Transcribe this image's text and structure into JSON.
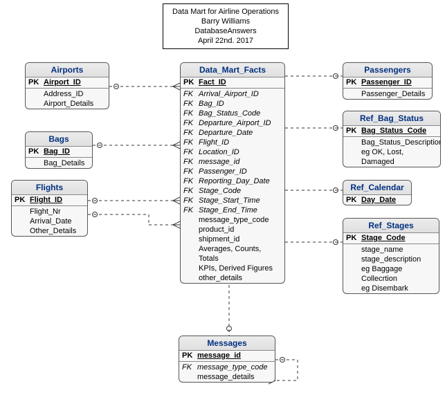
{
  "title": {
    "line1": "Data Mart for Airline Operations",
    "line2": "Barry Williams",
    "line3": "DatabaseAnswers",
    "line4": "April 22nd. 2017"
  },
  "entities": {
    "facts": {
      "name": "Data_Mart_Facts",
      "rows": [
        {
          "key": "PK",
          "style": "pk",
          "name": "Fact_ID"
        },
        {
          "key": "FK",
          "style": "fk",
          "name": "Arrival_Airport_ID"
        },
        {
          "key": "FK",
          "style": "fk",
          "name": "Bag_ID"
        },
        {
          "key": "FK",
          "style": "fk",
          "name": "Bag_Status_Code"
        },
        {
          "key": "FK",
          "style": "fk",
          "name": "Departure_Airport_ID"
        },
        {
          "key": "FK",
          "style": "fk",
          "name": "Departure_Date"
        },
        {
          "key": "FK",
          "style": "fk",
          "name": "Flight_ID"
        },
        {
          "key": "FK",
          "style": "fk",
          "name": "Location_ID"
        },
        {
          "key": "FK",
          "style": "fk",
          "name": "message_id"
        },
        {
          "key": "FK",
          "style": "fk",
          "name": "Passenger_ID"
        },
        {
          "key": "FK",
          "style": "fk",
          "name": "Reporting_Day_Date"
        },
        {
          "key": "FK",
          "style": "fk",
          "name": "Stage_Code"
        },
        {
          "key": "FK",
          "style": "fk",
          "name": "Stage_Start_Time"
        },
        {
          "key": "FK",
          "style": "fk",
          "name": "Stage_End_Time"
        },
        {
          "key": "",
          "style": "",
          "name": "message_type_code"
        },
        {
          "key": "",
          "style": "",
          "name": "product_id"
        },
        {
          "key": "",
          "style": "",
          "name": "shipment_id"
        },
        {
          "key": "",
          "style": "",
          "name": "Averages, Counts, Totals"
        },
        {
          "key": "",
          "style": "",
          "name": "KPIs, Derived Figures"
        },
        {
          "key": "",
          "style": "",
          "name": "other_details"
        }
      ]
    },
    "airports": {
      "name": "Airports",
      "rows": [
        {
          "key": "PK",
          "style": "pk",
          "name": "Airport_ID"
        },
        {
          "key": "",
          "style": "",
          "name": "Address_ID"
        },
        {
          "key": "",
          "style": "",
          "name": "Airport_Details"
        }
      ]
    },
    "bags": {
      "name": "Bags",
      "rows": [
        {
          "key": "PK",
          "style": "pk",
          "name": "Bag_ID"
        },
        {
          "key": "",
          "style": "",
          "name": "Bag_Details"
        }
      ]
    },
    "flights": {
      "name": "Flights",
      "rows": [
        {
          "key": "PK",
          "style": "pk",
          "name": "Flight_ID"
        },
        {
          "key": "",
          "style": "",
          "name": "Flight_Nr"
        },
        {
          "key": "",
          "style": "",
          "name": "Arrival_Date"
        },
        {
          "key": "",
          "style": "",
          "name": "Other_Details"
        }
      ]
    },
    "passengers": {
      "name": "Passengers",
      "rows": [
        {
          "key": "PK",
          "style": "pk",
          "name": "Passenger_ID"
        },
        {
          "key": "",
          "style": "",
          "name": "Passenger_Details"
        }
      ]
    },
    "ref_bag_status": {
      "name": "Ref_Bag_Status",
      "rows": [
        {
          "key": "PK",
          "style": "pk",
          "name": "Bag_Status_Code"
        },
        {
          "key": "",
          "style": "",
          "name": "Bag_Status_Description"
        },
        {
          "key": "",
          "style": "",
          "name": "eg OK, Lost, Damaged"
        }
      ]
    },
    "ref_calendar": {
      "name": "Ref_Calendar",
      "rows": [
        {
          "key": "PK",
          "style": "pk",
          "name": "Day_Date"
        }
      ]
    },
    "ref_stages": {
      "name": "Ref_Stages",
      "rows": [
        {
          "key": "PK",
          "style": "pk",
          "name": "Stage_Code"
        },
        {
          "key": "",
          "style": "",
          "name": "stage_name"
        },
        {
          "key": "",
          "style": "",
          "name": "stage_description"
        },
        {
          "key": "",
          "style": "",
          "name": "eg Baggage Collecrtion"
        },
        {
          "key": "",
          "style": "",
          "name": "eg Disembark"
        }
      ]
    },
    "messages": {
      "name": "Messages",
      "rows": [
        {
          "key": "PK",
          "style": "pk",
          "name": "message_id"
        },
        {
          "key": "FK",
          "style": "fk",
          "name": "message_type_code"
        },
        {
          "key": "",
          "style": "",
          "name": "message_details"
        }
      ]
    }
  }
}
